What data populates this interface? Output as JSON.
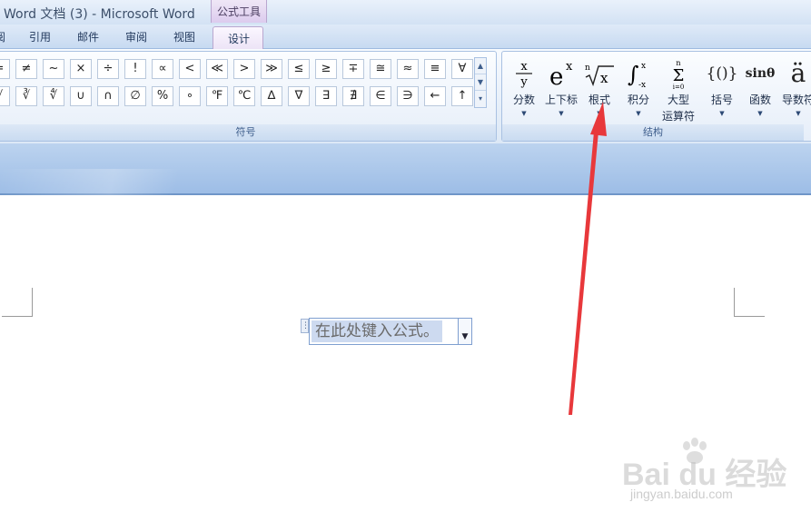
{
  "window": {
    "title": "Word 文档 (3) - Microsoft Word"
  },
  "context_group": {
    "label": "公式工具"
  },
  "tabs": [
    {
      "label": "引用"
    },
    {
      "label": "邮件"
    },
    {
      "label": "审阅"
    },
    {
      "label": "视图"
    },
    {
      "label": "设计",
      "active": true
    }
  ],
  "partial_tab": {
    "label": "阅"
  },
  "ribbon": {
    "symbols_group": {
      "label": "符号",
      "row1": [
        "=",
        "≠",
        "~",
        "×",
        "÷",
        "!",
        "∝",
        "<",
        "≪",
        ">",
        "≫",
        "≤",
        "≥",
        "∓",
        "≅",
        "≈",
        "≡",
        "∀"
      ],
      "row2": [
        "√",
        "∛",
        "∜",
        "∪",
        "∩",
        "∅",
        "%",
        "∘",
        "℉",
        "℃",
        "∆",
        "∇",
        "∃",
        "∄",
        "∈",
        "∋",
        "←",
        "↑"
      ]
    },
    "structures_group": {
      "label": "结构",
      "items": [
        {
          "label": "分数",
          "icon": "fraction-icon"
        },
        {
          "label": "上下标",
          "icon": "script-icon"
        },
        {
          "label": "根式",
          "icon": "radical-icon"
        },
        {
          "label": "积分",
          "icon": "integral-icon"
        },
        {
          "label": "大型",
          "label2": "运算符",
          "icon": "large-operator-icon"
        },
        {
          "label": "括号",
          "icon": "bracket-icon"
        },
        {
          "label": "函数",
          "icon": "function-icon"
        },
        {
          "label": "导数符",
          "icon": "accent-icon"
        }
      ]
    }
  },
  "equation": {
    "placeholder": "在此处键入公式。"
  },
  "watermark": {
    "brand": "Bai du 经验",
    "site": "jingyan.baidu.com"
  },
  "colors": {
    "arrow": "#e8383b",
    "selection": "#cddaf0",
    "active_tab": "#ece3f6"
  }
}
